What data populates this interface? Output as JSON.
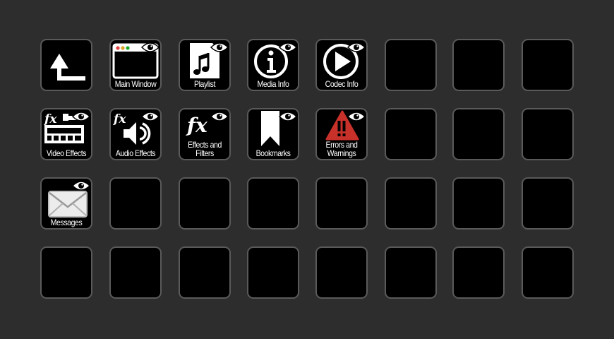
{
  "deck": {
    "keys": [
      {
        "id": "back",
        "icon": "back-arrow-icon",
        "label": "",
        "show_eye": false
      },
      {
        "id": "main-window",
        "icon": "window-icon",
        "label": "Main Window",
        "show_eye": true
      },
      {
        "id": "playlist",
        "icon": "playlist-icon",
        "label": "Playlist",
        "show_eye": true
      },
      {
        "id": "media-info",
        "icon": "info-icon",
        "label": "Media Info",
        "show_eye": true
      },
      {
        "id": "codec-info",
        "icon": "play-circle-icon",
        "label": "Codec Info",
        "show_eye": true
      },
      {
        "id": "video-effects",
        "icon": "video-effects-icon",
        "label": "Video Effects",
        "show_eye": true
      },
      {
        "id": "audio-effects",
        "icon": "audio-effects-icon",
        "label": "Audio Effects",
        "show_eye": true
      },
      {
        "id": "effects-filters",
        "icon": "fx-icon",
        "label": "Effects and\nFilters",
        "show_eye": true
      },
      {
        "id": "bookmarks",
        "icon": "bookmark-icon",
        "label": "Bookmarks",
        "show_eye": true
      },
      {
        "id": "errors-warnings",
        "icon": "warning-icon",
        "label": "Errors and\nWarnings",
        "show_eye": true
      },
      {
        "id": "messages",
        "icon": "envelope-icon",
        "label": "Messages",
        "show_eye": true
      }
    ],
    "colors": {
      "background": "#2d2d2d",
      "key": "#000000",
      "key_border": "#5a5a5a",
      "warning": "#c8312a",
      "traffic_red": "#e0443e",
      "traffic_yellow": "#dea123",
      "traffic_green": "#1aab29"
    }
  }
}
